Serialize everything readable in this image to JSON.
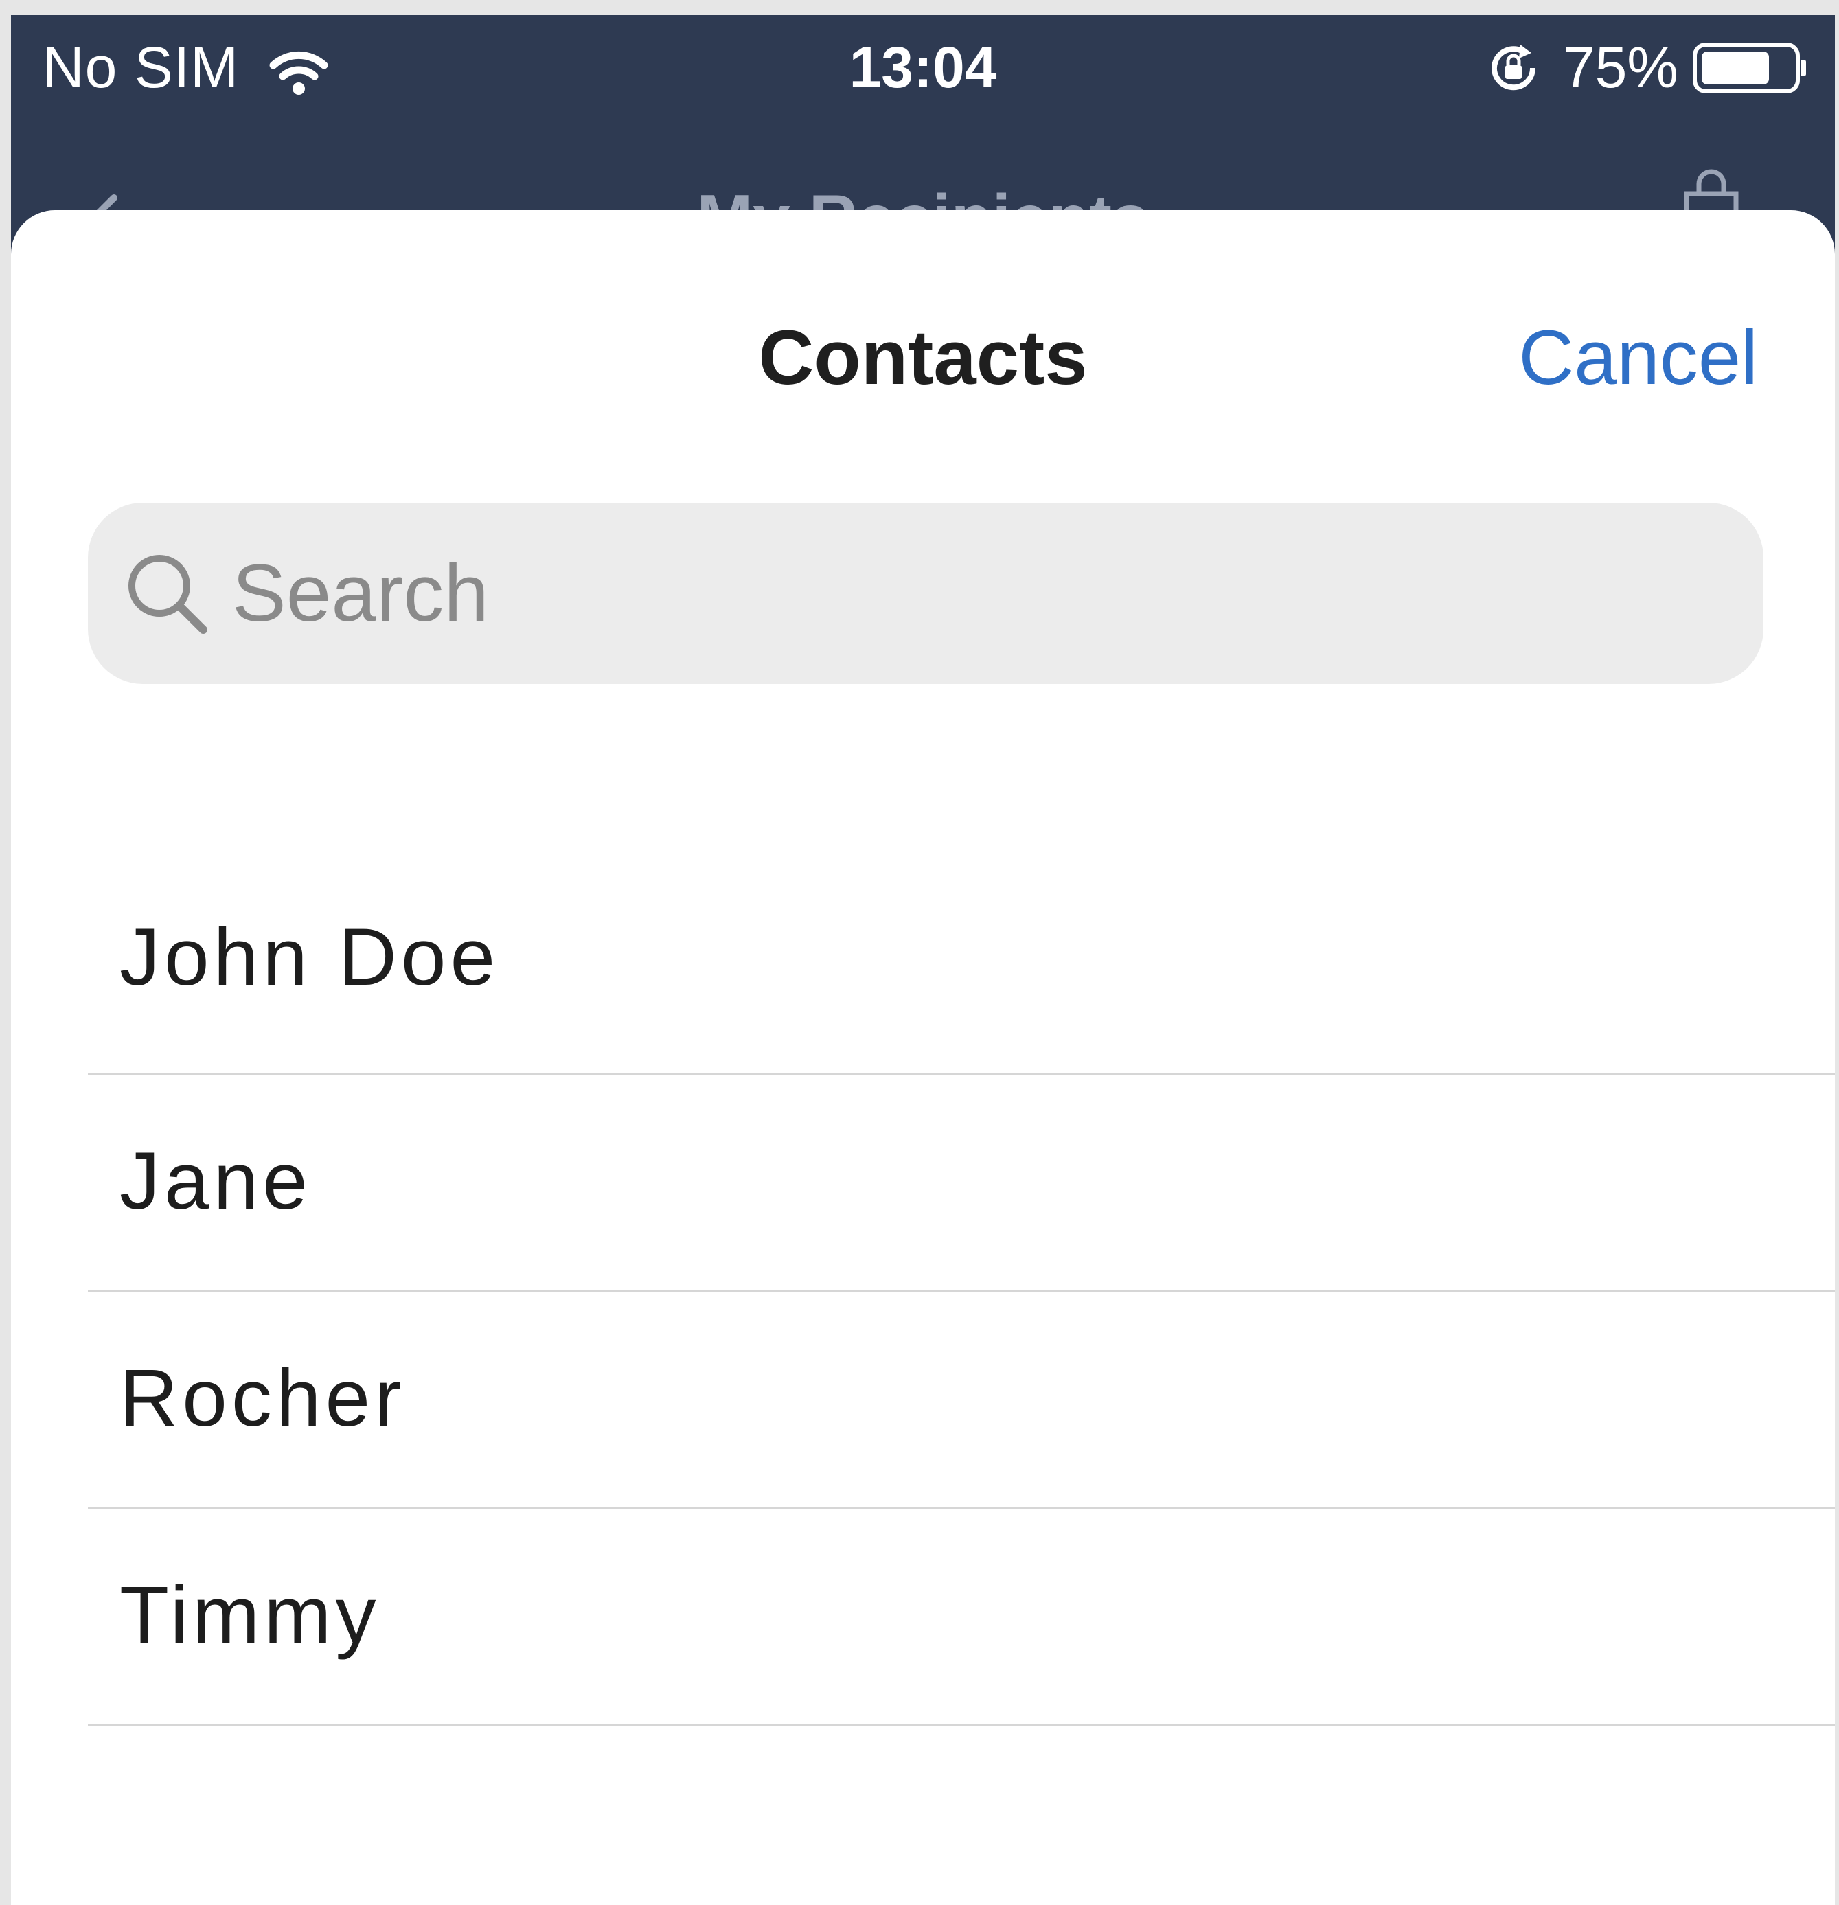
{
  "status_bar": {
    "carrier": "No SIM",
    "time": "13:04",
    "battery_percent": "75%",
    "battery_level": 0.75,
    "icons": [
      "wifi-icon",
      "orientation-lock-icon",
      "battery-icon"
    ]
  },
  "background_screen": {
    "title": "My Recipients",
    "icons": [
      "back-chevron-icon",
      "shopping-bag-icon"
    ]
  },
  "sheet": {
    "title": "Contacts",
    "cancel_label": "Cancel"
  },
  "search": {
    "placeholder": "Search",
    "value": ""
  },
  "contacts": [
    {
      "name": "John Doe"
    },
    {
      "name": "Jane"
    },
    {
      "name": "Rocher"
    },
    {
      "name": "Timmy"
    }
  ],
  "colors": {
    "header_background": "#2e3a52",
    "accent": "#2f6fc6",
    "search_background": "#ececec",
    "separator": "#d6d6d6"
  }
}
